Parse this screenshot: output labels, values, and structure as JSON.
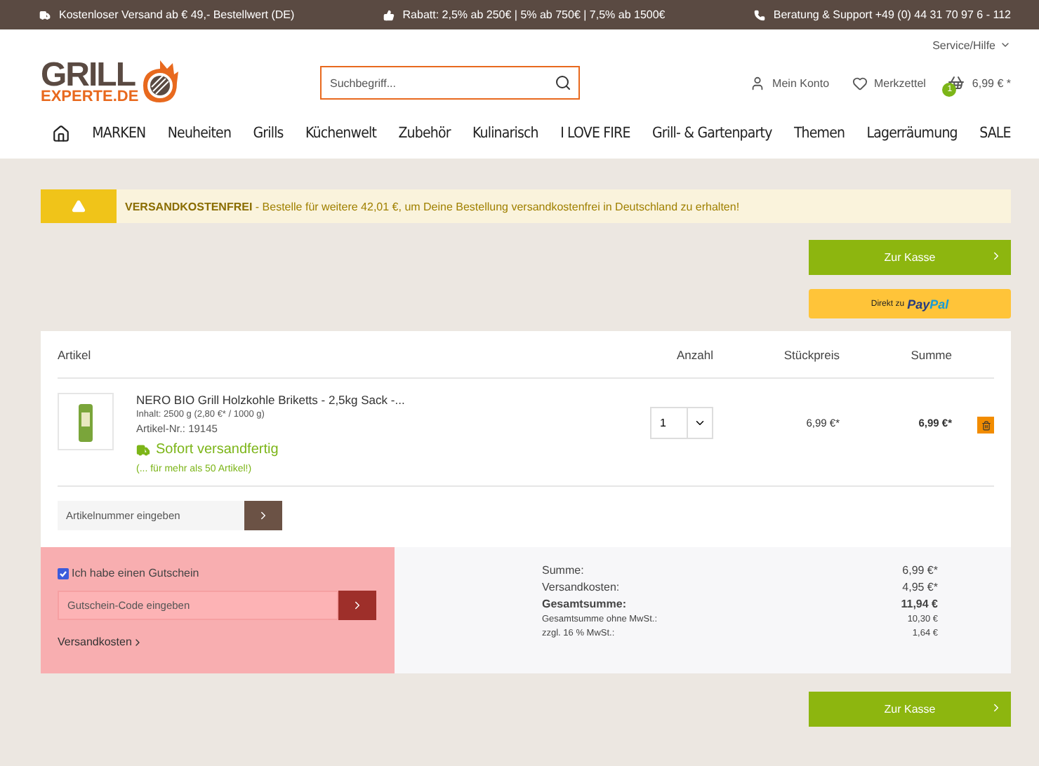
{
  "top_bar": [
    "Kostenloser Versand ab € 49,- Bestellwert (DE)",
    "Rabatt: 2,5% ab 250€ | 5% ab 750€ | 7,5% ab 1500€",
    "Beratung & Support +49 (0) 44 31 70 97 6 - 112"
  ],
  "service_menu": "Service/Hilfe",
  "logo": {
    "line_1": "GRILL",
    "line_2": "EXPERTE.DE"
  },
  "search": {
    "placeholder": "Suchbegriff..."
  },
  "account": "Mein Konto",
  "wishlist": "Merkzettel",
  "cart": {
    "count": "1",
    "total": "6,99 € *"
  },
  "nav": [
    "MARKEN",
    "Neuheiten",
    "Grills",
    "Küchenwelt",
    "Zubehör",
    "Kulinarisch",
    "I LOVE FIRE",
    "Grill- & Gartenparty",
    "Themen",
    "Lagerräumung",
    "SALE"
  ],
  "alert": {
    "title": "VERSANDKOSTENFREI",
    "text": " - Bestelle für weitere 42,01 €, um Deine Bestellung versandkostenfrei in Deutschland zu erhalten!"
  },
  "checkout_button": "Zur Kasse",
  "paypal": {
    "prefix": "Direkt zu",
    "brand_1": "Pay",
    "brand_2": "Pal"
  },
  "table": {
    "columns": [
      "Artikel",
      "Anzahl",
      "Stückpreis",
      "Summe"
    ],
    "rows": [
      {
        "name": "NERO BIO Grill Holzkohle Briketts - 2,5kg Sack -...",
        "content": "Inhalt: 2500 g (2,80 €* / 1000 g)",
        "number": "Artikel-Nr.: 19145",
        "availability": "Sofort versandfertig",
        "stock_note": "(... für mehr als 50 Artikel!)",
        "quantity": "1",
        "unit_price": "6,99 €*",
        "total": "6,99 €*"
      }
    ]
  },
  "article_number": {
    "placeholder": "Artikelnummer eingeben"
  },
  "voucher": {
    "label": "Ich habe einen Gutschein",
    "checked": true,
    "placeholder": "Gutschein-Code eingeben",
    "shipping_link": "Versandkosten"
  },
  "summary": [
    {
      "label": "Summe:",
      "value": "6,99 €*",
      "kind": "normal"
    },
    {
      "label": "Versandkosten:",
      "value": "4,95 €*",
      "kind": "normal"
    },
    {
      "label": "Gesamtsumme:",
      "value": "11,94 €",
      "kind": "total"
    },
    {
      "label": "Gesamtsumme ohne MwSt.:",
      "value": "10,30 €",
      "kind": "small"
    },
    {
      "label": "zzgl. 16 % MwSt.:",
      "value": "1,64 €",
      "kind": "small"
    }
  ],
  "bottom_checkout_button": "Zur Kasse"
}
